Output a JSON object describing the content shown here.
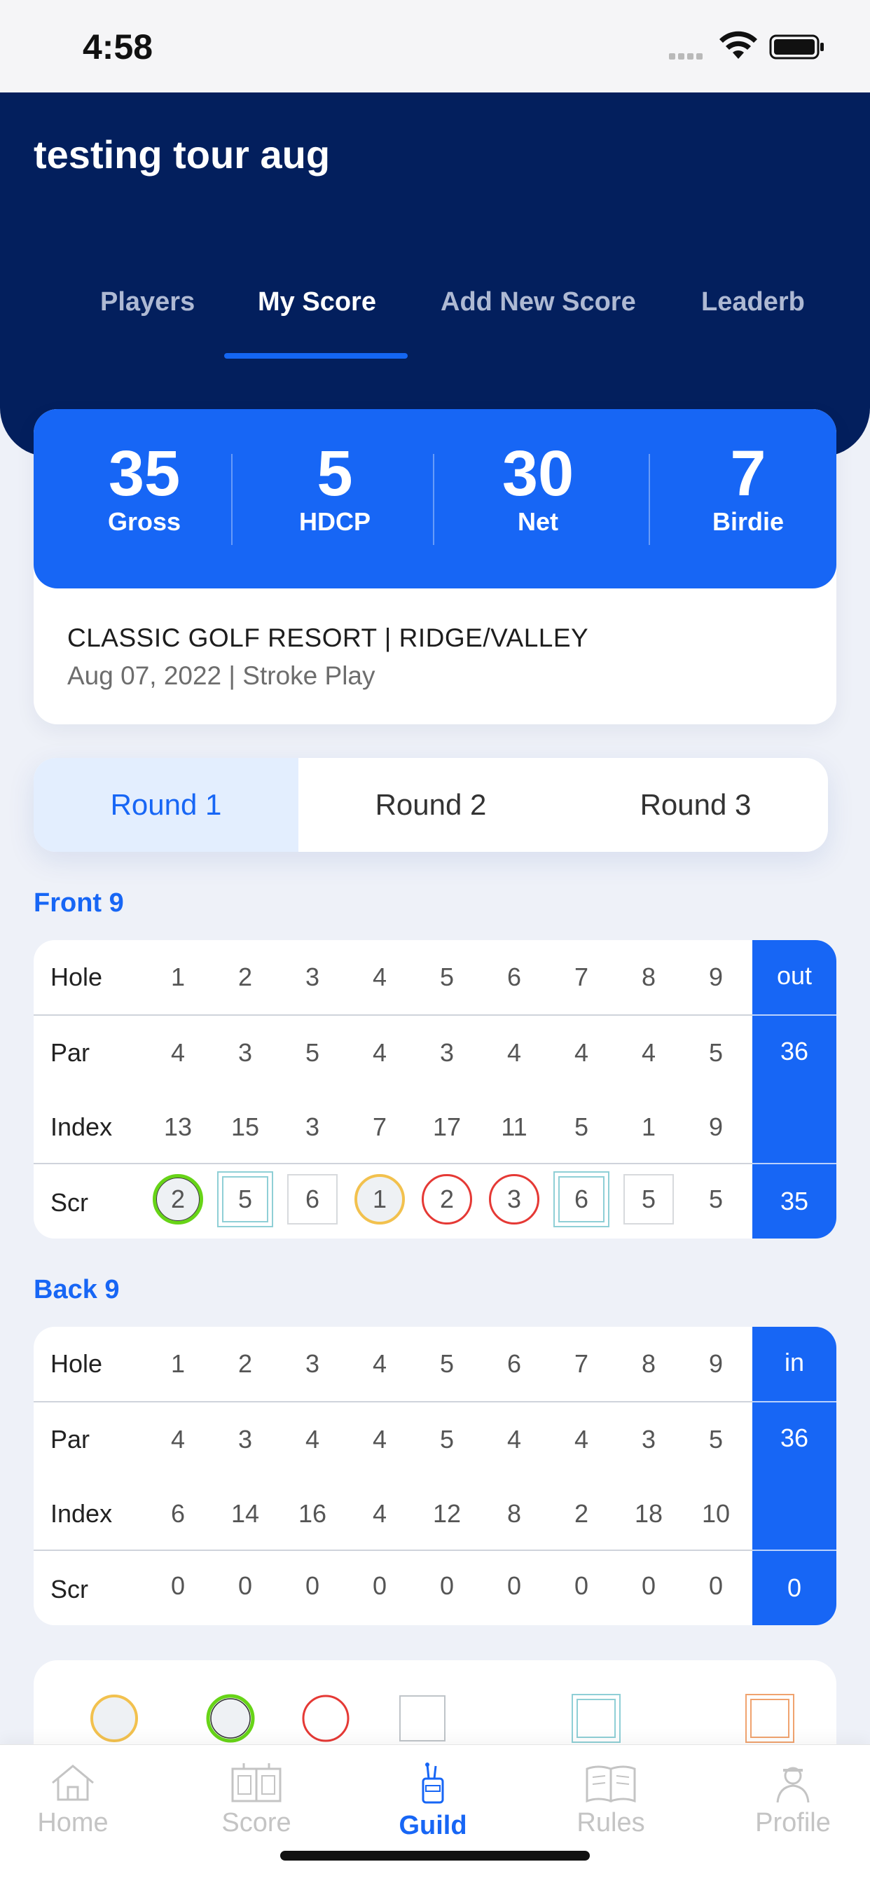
{
  "status": {
    "time": "4:58"
  },
  "header": {
    "title": "testing tour aug",
    "tabs": [
      "Players",
      "My Score",
      "Add New Score",
      "Leaderb"
    ],
    "active_tab": "My Score"
  },
  "summary": {
    "stats": [
      {
        "value": "35",
        "label": "Gross"
      },
      {
        "value": "5",
        "label": "HDCP"
      },
      {
        "value": "30",
        "label": "Net"
      },
      {
        "value": "7",
        "label": "Birdie"
      }
    ],
    "course": "CLASSIC GOLF RESORT | RIDGE/VALLEY",
    "date_format": "Aug 07, 2022 | Stroke Play"
  },
  "rounds": {
    "tabs": [
      "Round 1",
      "Round 2",
      "Round 3"
    ],
    "active": "Round 1"
  },
  "front9": {
    "title": "Front 9",
    "labels": {
      "hole": "Hole",
      "par": "Par",
      "index": "Index",
      "score": "Scr"
    },
    "holes": [
      "1",
      "2",
      "3",
      "4",
      "5",
      "6",
      "7",
      "8",
      "9"
    ],
    "par": [
      "4",
      "3",
      "5",
      "4",
      "3",
      "4",
      "4",
      "4",
      "5"
    ],
    "index": [
      "13",
      "15",
      "3",
      "7",
      "17",
      "11",
      "5",
      "1",
      "9"
    ],
    "score": [
      "2",
      "5",
      "6",
      "1",
      "2",
      "3",
      "6",
      "5",
      "5"
    ],
    "score_marks": [
      "eagle",
      "double-square",
      "square",
      "albatross",
      "circle",
      "circle",
      "double-square",
      "square",
      "none"
    ],
    "total_label": "out",
    "total_par": "36",
    "total_score": "35"
  },
  "back9": {
    "title": "Back 9",
    "labels": {
      "hole": "Hole",
      "par": "Par",
      "index": "Index",
      "score": "Scr"
    },
    "holes": [
      "1",
      "2",
      "3",
      "4",
      "5",
      "6",
      "7",
      "8",
      "9"
    ],
    "par": [
      "4",
      "3",
      "4",
      "4",
      "5",
      "4",
      "4",
      "3",
      "5"
    ],
    "index": [
      "6",
      "14",
      "16",
      "4",
      "12",
      "8",
      "2",
      "18",
      "10"
    ],
    "score": [
      "0",
      "0",
      "0",
      "0",
      "0",
      "0",
      "0",
      "0",
      "0"
    ],
    "total_label": "in",
    "total_par": "36",
    "total_score": "0"
  },
  "legend": [
    "albatross",
    "eagle",
    "birdie",
    "bogey",
    "double-bogey",
    "triple-bogey"
  ],
  "bottom_nav": {
    "items": [
      "Home",
      "Score",
      "Guild",
      "Rules",
      "Profile"
    ],
    "active": "Guild"
  },
  "colors": {
    "navy": "#031f5d",
    "accent": "#1766f5",
    "eagle": "#67d417",
    "albatross": "#f2c14e",
    "birdie": "#e53935",
    "bogey_square": "#bfc4c9",
    "double_bogey": "#8fcfd6",
    "triple_bogey": "#f0a36f"
  }
}
